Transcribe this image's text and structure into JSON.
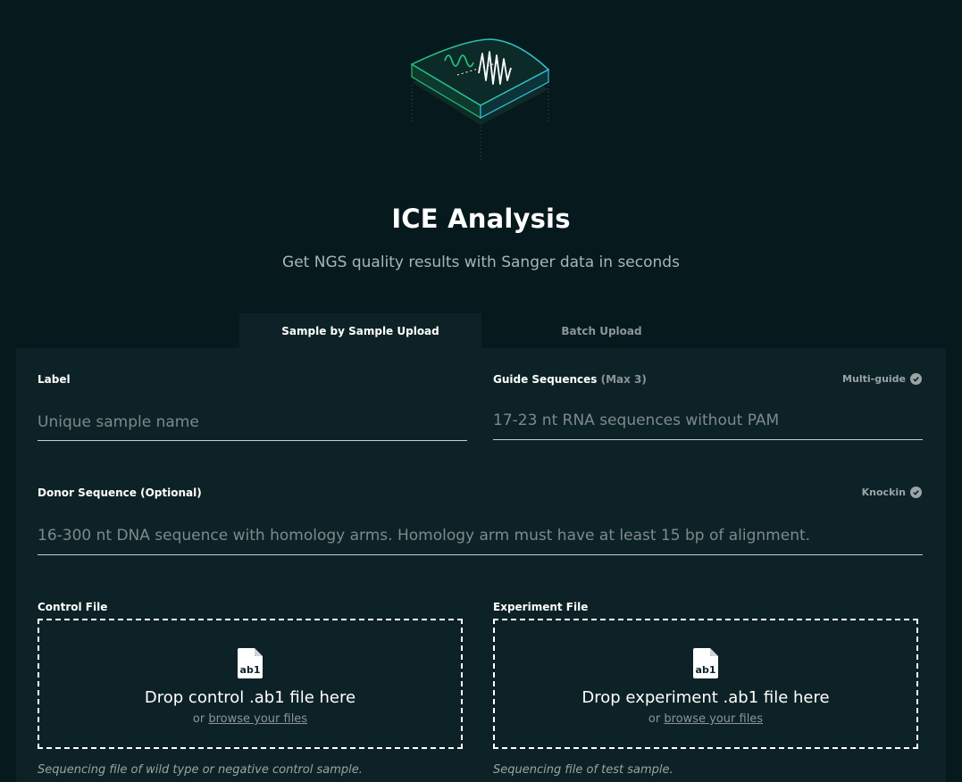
{
  "header": {
    "title": "ICE Analysis",
    "subtitle": "Get NGS quality results with Sanger data in seconds"
  },
  "tabs": [
    {
      "label": "Sample by Sample Upload",
      "active": true
    },
    {
      "label": "Batch Upload",
      "active": false
    }
  ],
  "form": {
    "label_field": {
      "label": "Label",
      "placeholder": "Unique sample name",
      "value": ""
    },
    "guide_field": {
      "label": "Guide Sequences",
      "label_note": "(Max 3)",
      "badge": "Multi-guide",
      "placeholder": "17-23 nt RNA sequences without PAM",
      "value": ""
    },
    "donor_field": {
      "label": "Donor Sequence (Optional)",
      "badge": "Knockin",
      "placeholder": "16-300 nt DNA sequence with homology arms. Homology arm must have at least 15 bp of alignment.",
      "value": ""
    },
    "control_file": {
      "label": "Control File",
      "icon_text": "ab1",
      "drop_text": "Drop control .ab1 file here",
      "or_text": "or",
      "browse_text": "browse your files",
      "help": "Sequencing file of wild type or negative control sample."
    },
    "experiment_file": {
      "label": "Experiment File",
      "icon_text": "ab1",
      "drop_text": "Drop experiment .ab1 file here",
      "or_text": "or",
      "browse_text": "browse your files",
      "help": "Sequencing file of test sample."
    }
  },
  "colors": {
    "background": "#061a1d",
    "panel": "#0d2226",
    "accent_green": "#22c07a",
    "accent_cyan": "#33c3e0"
  }
}
